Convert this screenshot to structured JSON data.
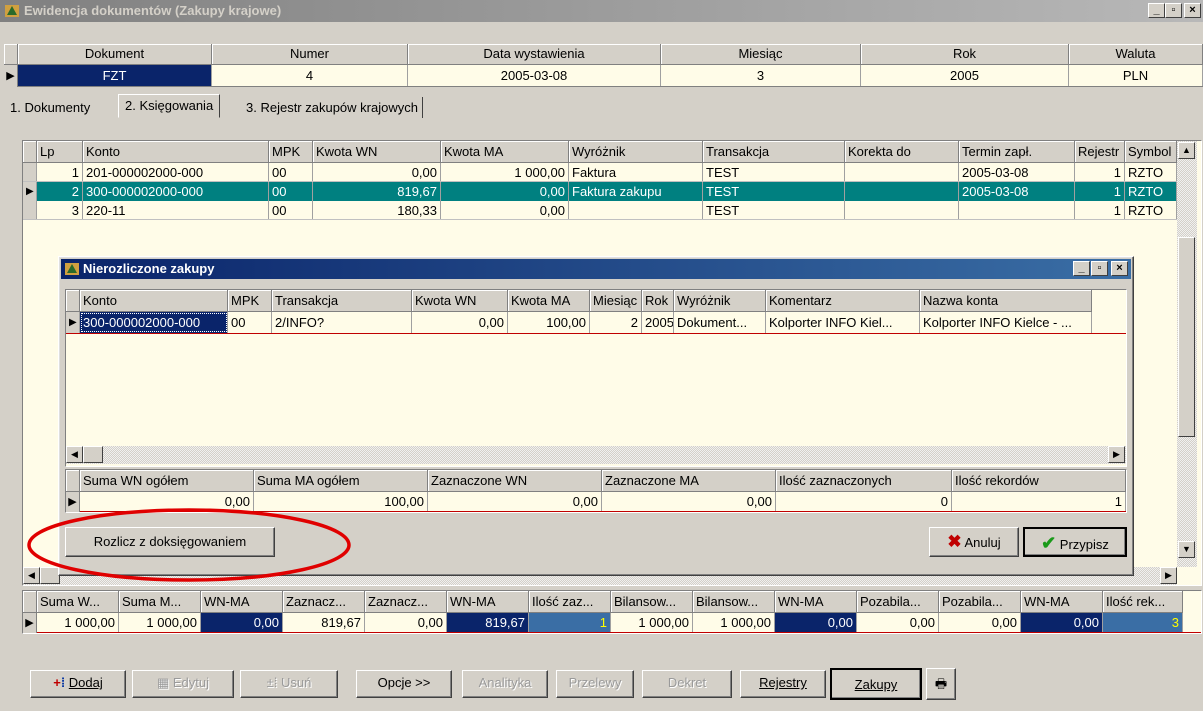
{
  "window": {
    "title": "Ewidencja dokumentów (Zakupy krajowe)"
  },
  "header": {
    "columns": [
      "Dokument",
      "Numer",
      "Data wystawienia",
      "Miesiąc",
      "Rok",
      "Waluta"
    ],
    "values": [
      "FZT",
      "4",
      "2005-03-08",
      "3",
      "2005",
      "PLN"
    ]
  },
  "tabs": [
    {
      "label": "1. Dokumenty"
    },
    {
      "label": "2. Księgowania"
    },
    {
      "label": "3. Rejestr zakupów krajowych"
    }
  ],
  "entries": {
    "columns": [
      "Lp",
      "Konto",
      "MPK",
      "Kwota WN",
      "Kwota MA",
      "Wyróżnik",
      "Transakcja",
      "Korekta do",
      "Termin zapł.",
      "Rejestr",
      "Symbol"
    ],
    "rows": [
      [
        "1",
        "201-000002000-000",
        "00",
        "0,00",
        "1 000,00",
        "Faktura",
        "TEST",
        "",
        "2005-03-08",
        "1",
        "RZTO"
      ],
      [
        "2",
        "300-000002000-000",
        "00",
        "819,67",
        "0,00",
        "Faktura zakupu",
        "TEST",
        "",
        "2005-03-08",
        "1",
        "RZTO"
      ],
      [
        "3",
        "220-11",
        "00",
        "180,33",
        "0,00",
        "",
        "TEST",
        "",
        "",
        "1",
        "RZTO"
      ]
    ]
  },
  "dialog": {
    "title": "Nierozliczone zakupy",
    "columns": [
      "Konto",
      "MPK",
      "Transakcja",
      "Kwota WN",
      "Kwota MA",
      "Miesiąc",
      "Rok",
      "Wyróżnik",
      "Komentarz",
      "Nazwa konta"
    ],
    "rows": [
      [
        "300-000002000-000",
        "00",
        "2/INFO?",
        "0,00",
        "100,00",
        "2",
        "2005",
        "Dokument...",
        "Kolporter INFO Kiel...",
        "Kolporter INFO Kielce - ..."
      ]
    ],
    "summary_columns": [
      "Suma WN ogółem",
      "Suma MA ogółem",
      "Zaznaczone WN",
      "Zaznaczone MA",
      "Ilość zaznaczonych",
      "Ilość rekordów"
    ],
    "summary_values": [
      "0,00",
      "100,00",
      "0,00",
      "0,00",
      "0",
      "1"
    ],
    "settle_button": "Rozlicz z doksięgowaniem",
    "cancel_button": "Anuluj",
    "assign_button": "Przypisz"
  },
  "totals": {
    "columns": [
      "Suma W...",
      "Suma M...",
      "WN-MA",
      "Zaznacz...",
      "Zaznacz...",
      "WN-MA",
      "Ilość zaz...",
      "Bilansow...",
      "Bilansow...",
      "WN-MA",
      "Pozabila...",
      "Pozabila...",
      "WN-MA",
      "Ilość rek..."
    ],
    "values": [
      "1 000,00",
      "1 000,00",
      "0,00",
      "819,67",
      "0,00",
      "819,67",
      "1",
      "1 000,00",
      "1 000,00",
      "0,00",
      "0,00",
      "0,00",
      "0,00",
      "3"
    ]
  },
  "toolbar": {
    "add": "Dodaj",
    "edit": "Edytuj",
    "delete": "Usuń",
    "options": "Opcje >>",
    "analytics": "Analityka",
    "transfers": "Przelewy",
    "decree": "Dekret",
    "registers": "Rejestry",
    "purchases": "Zakupy"
  },
  "colors": {
    "title_inactive": "#808080",
    "selection": "#0a246a",
    "teal": "#008080",
    "highlight_ellipse": "#e00000",
    "grid_bg": "#fffce8"
  }
}
